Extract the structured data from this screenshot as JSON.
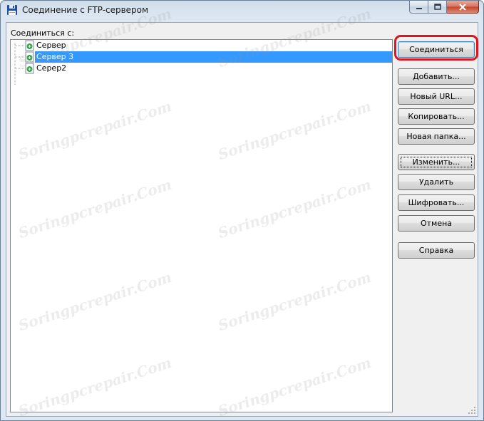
{
  "window": {
    "title": "Соединение с FTP-сервером"
  },
  "list": {
    "label": "Соединиться с:",
    "items": [
      {
        "label": "Сервер",
        "selected": false
      },
      {
        "label": "Сервер 3",
        "selected": true
      },
      {
        "label": "Серер2",
        "selected": false
      }
    ]
  },
  "buttons": {
    "connect": "Соединиться",
    "add": "Добавить...",
    "new_url": "Новый URL...",
    "copy": "Копировать...",
    "new_folder": "Новая папка...",
    "edit": "Изменить...",
    "delete": "Удалить",
    "encrypt": "Шифровать...",
    "cancel": "Отмена",
    "help": "Справка"
  },
  "watermark": "Soringpcrepair.Com",
  "colors": {
    "selection": "#3399ff",
    "highlight_ring": "#e0141c"
  }
}
